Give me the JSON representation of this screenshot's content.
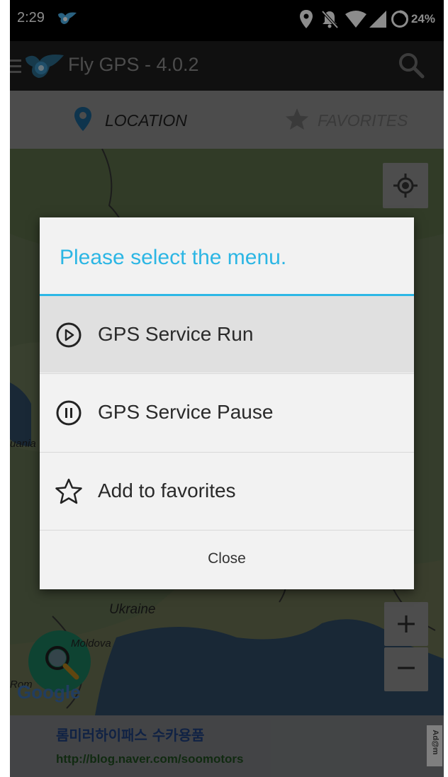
{
  "status_bar": {
    "time": "2:29",
    "battery_percent": "24%",
    "icons": [
      "bird-logo-icon",
      "location-pin-icon",
      "notifications-off-icon",
      "wifi-icon",
      "signal-icon",
      "battery-circle-icon"
    ]
  },
  "app_bar": {
    "title": "Fly GPS - 4.0.2",
    "icons": [
      "menu-icon",
      "app-logo-icon",
      "search-icon"
    ]
  },
  "tabs": [
    {
      "label": "LOCATION",
      "icon": "location-pin-icon",
      "selected": true
    },
    {
      "label": "FAVORITES",
      "icon": "star-icon",
      "selected": false
    }
  ],
  "map": {
    "labels": {
      "ukraine": "Ukraine",
      "moldova": "Moldova",
      "lithuania_partial": "uania",
      "romania_partial": "Rom",
      "google": "Google"
    },
    "controls": [
      "my-location-button",
      "zoom-in-button",
      "zoom-out-button",
      "search-fab"
    ],
    "zoom_in_label": "+",
    "zoom_out_label": "−"
  },
  "dialog": {
    "title": "Please select the menu.",
    "items": [
      {
        "label": "GPS Service Run",
        "icon": "play-circle-icon",
        "highlighted": true
      },
      {
        "label": "GPS Service Pause",
        "icon": "pause-circle-icon",
        "highlighted": false
      },
      {
        "label": "Add to favorites",
        "icon": "star-outline-icon",
        "highlighted": false
      }
    ],
    "close_label": "Close"
  },
  "ad": {
    "line1": "롬미러하이패스 수카용품",
    "line2": "http://blog.naver.com/soomotors",
    "badge": "Ad@m"
  },
  "colors": {
    "accent": "#2cb6e4",
    "tab_indicator": "#1c5a80",
    "dialog_bg": "#f2f2f2",
    "highlight_bg": "#e0e0e0",
    "fab": "#1a7a5c"
  }
}
